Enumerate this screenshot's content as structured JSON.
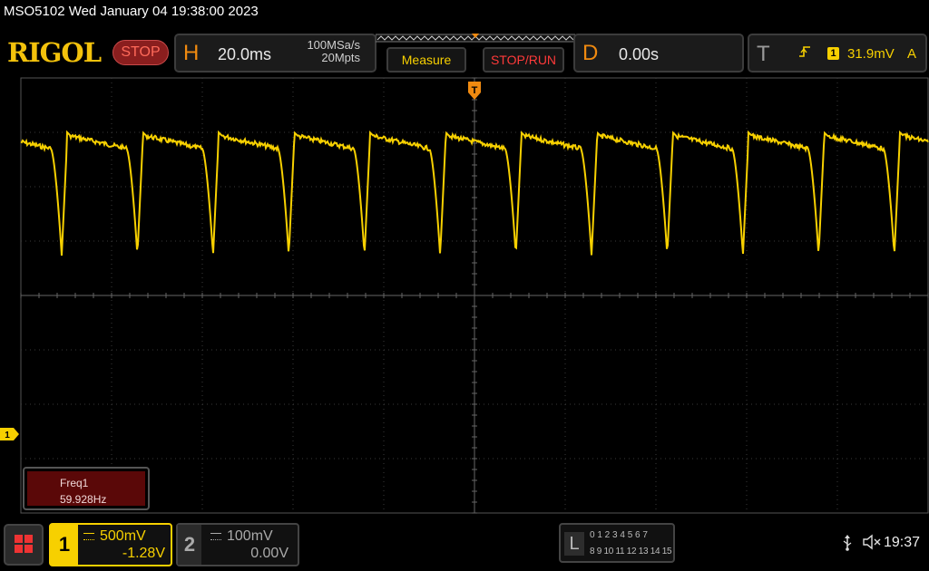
{
  "title_line": "MSO5102  Wed January 04 19:38:00 2023",
  "logo": "RIGOL",
  "run_state": "STOP",
  "horizontal": {
    "letter": "H",
    "timebase": "20.0ms",
    "sample_rate": "100MSa/s",
    "memory_depth": "20Mpts"
  },
  "buttons": {
    "measure": "Measure",
    "stop_run": "STOP/RUN"
  },
  "delay": {
    "letter": "D",
    "value": "0.00s"
  },
  "trigger": {
    "letter": "T",
    "edge_icon": "rising-edge-icon",
    "source": "1",
    "level": "31.9mV",
    "mode": "A",
    "marker": "T"
  },
  "measurement": {
    "name": "Freq1",
    "value": "59.928Hz"
  },
  "channel1": {
    "number": "1",
    "scale": "500mV",
    "offset": "-1.28V",
    "color": "#f7d000",
    "marker": "1"
  },
  "channel2": {
    "number": "2",
    "scale": "100mV",
    "offset": "0.00V",
    "color": "#9a9a9a"
  },
  "logic": {
    "letter": "L",
    "row1": "0 1 2 3   4 5 6 7",
    "row2": "8  9 10 11  12 13 14 15"
  },
  "status": {
    "usb_icon": "usb-icon",
    "speaker_icon": "speaker-muted-icon",
    "time": "19:37"
  },
  "colors": {
    "trace": "#f7d000",
    "grid": "#3a3a3a",
    "accent": "#f08a10",
    "stop": "#ff3a3a"
  },
  "chart_data": {
    "type": "line",
    "waveform": "periodic sag with sharp negative dips",
    "frequency_hz": 59.928,
    "timebase_per_div_ms": 20.0,
    "volts_per_div": 0.5,
    "offset_v": -1.28,
    "trigger_level_v": 0.0319,
    "dip_count_on_screen": 12
  }
}
